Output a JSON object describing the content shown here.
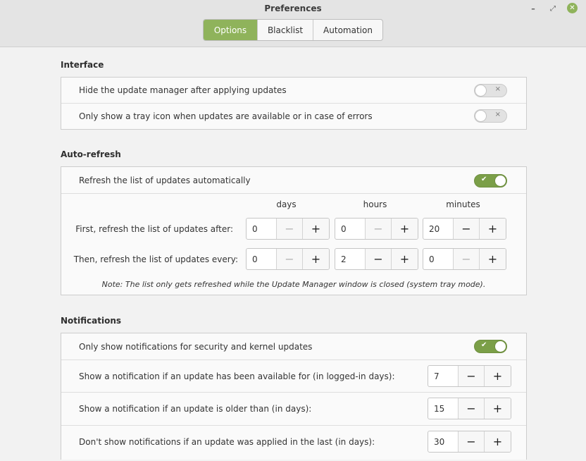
{
  "window": {
    "title": "Preferences",
    "controls": {
      "minimize": "–",
      "maximize": "⤢",
      "close": "✕"
    }
  },
  "tabs": [
    {
      "label": "Options",
      "active": true
    },
    {
      "label": "Blacklist",
      "active": false
    },
    {
      "label": "Automation",
      "active": false
    }
  ],
  "interface": {
    "heading": "Interface",
    "rows": [
      {
        "label": "Hide the update manager after applying updates",
        "enabled": false
      },
      {
        "label": "Only show a tray icon when updates are available or in case of errors",
        "enabled": false
      }
    ]
  },
  "autorefresh": {
    "heading": "Auto-refresh",
    "toggle_label": "Refresh the list of updates automatically",
    "toggle_enabled": true,
    "columns": [
      "days",
      "hours",
      "minutes"
    ],
    "first_label": "First, refresh the list of updates after:",
    "first_values": [
      "0",
      "0",
      "20"
    ],
    "then_label": "Then, refresh the list of updates every:",
    "then_values": [
      "0",
      "2",
      "0"
    ],
    "note": "Note: The list only gets refreshed while the Update Manager window is closed (system tray mode)."
  },
  "notifications": {
    "heading": "Notifications",
    "security_label": "Only show notifications for security and kernel updates",
    "security_enabled": true,
    "rows": [
      {
        "label": "Show a notification if an update has been available for (in logged-in days):",
        "value": "7"
      },
      {
        "label": "Show a notification if an update is older than (in days):",
        "value": "15"
      },
      {
        "label": "Don't show notifications if an update was applied in the last (in days):",
        "value": "30"
      }
    ]
  },
  "glyphs": {
    "minus": "−",
    "plus": "+",
    "check": "✔",
    "cross": "×"
  },
  "colors": {
    "accent": "#8fb35b",
    "switch_on": "#7b9f48"
  }
}
